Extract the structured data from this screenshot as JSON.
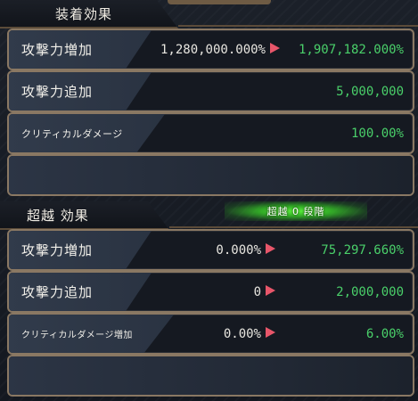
{
  "equip_section": {
    "title": "装着効果",
    "rows": [
      {
        "label": "攻撃力増加",
        "before": "1,280,000.000%",
        "after": "1,907,182.000%"
      },
      {
        "label": "攻撃力追加",
        "after": "5,000,000"
      },
      {
        "label": "クリティカルダメージ",
        "after": "100.00%"
      },
      {
        "label": "",
        "after": ""
      }
    ]
  },
  "transcend_section": {
    "title": "超越 効果",
    "stage_badge": "超越 0 段階",
    "rows": [
      {
        "label": "攻撃力増加",
        "before": "0.000%",
        "after": "75,297.660%"
      },
      {
        "label": "攻撃力追加",
        "before": "0",
        "after": "2,000,000"
      },
      {
        "label": "クリティカルダメージ増加",
        "before": "0.00%",
        "after": "6.00%"
      },
      {
        "label": "",
        "after": ""
      }
    ]
  },
  "colors": {
    "value_green": "#4ad06a",
    "arrow_red": "#e8566a",
    "badge_glow": "#5eff3c",
    "border_gold": "#8a7863"
  },
  "icons": {
    "increase_arrow": "right-triangle-icon"
  }
}
